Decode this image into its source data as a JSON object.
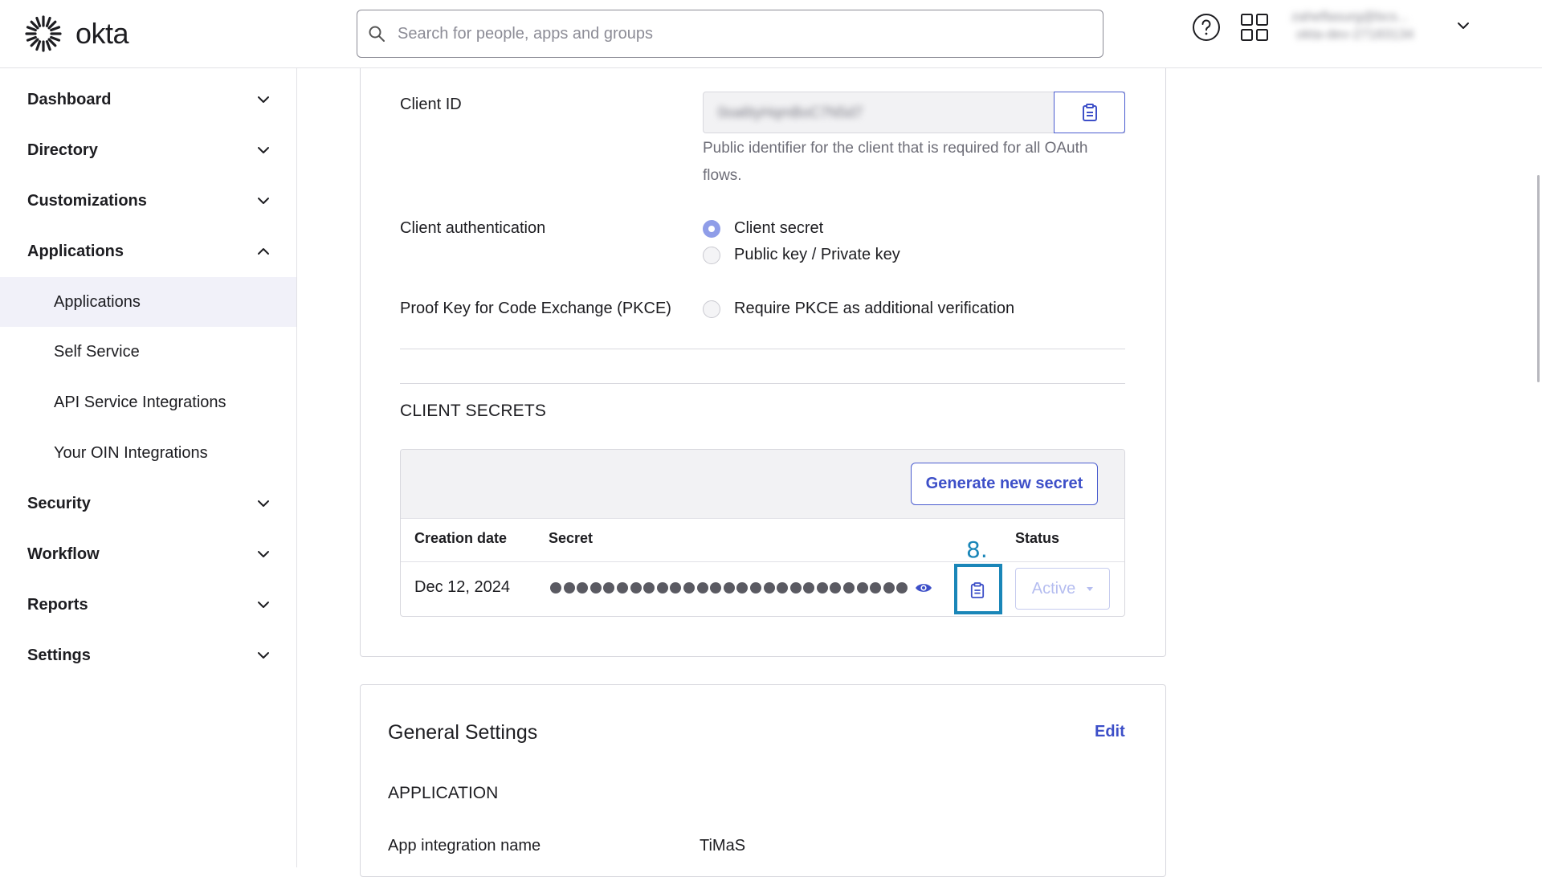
{
  "brand": {
    "name": "okta"
  },
  "search": {
    "placeholder": "Search for people, apps and groups"
  },
  "header": {
    "user_email": "zaheflasurg@bcs...",
    "user_org": "okta-dev-27183134",
    "help_icon": "help-circle-icon",
    "apps_icon": "grid-apps-icon"
  },
  "sidebar": {
    "items": [
      {
        "label": "Dashboard",
        "expanded": false
      },
      {
        "label": "Directory",
        "expanded": false
      },
      {
        "label": "Customizations",
        "expanded": false
      },
      {
        "label": "Applications",
        "expanded": true
      },
      {
        "label": "Security",
        "expanded": false
      },
      {
        "label": "Workflow",
        "expanded": false
      },
      {
        "label": "Reports",
        "expanded": false
      },
      {
        "label": "Settings",
        "expanded": false
      }
    ],
    "sub_items": [
      {
        "label": "Applications",
        "active": true
      },
      {
        "label": "Self Service",
        "active": false
      },
      {
        "label": "API Service Integrations",
        "active": false
      },
      {
        "label": "Your OIN Integrations",
        "active": false
      }
    ]
  },
  "client_credentials": {
    "client_id_label": "Client ID",
    "client_id_value": "0oa6tyHqmBoC7N5d7",
    "client_id_help": "Public identifier for the client that is required for all OAuth flows.",
    "client_auth_label": "Client authentication",
    "client_auth_options": [
      {
        "label": "Client secret",
        "checked": true
      },
      {
        "label": "Public key / Private key",
        "checked": false
      }
    ],
    "pkce_label": "Proof Key for Code Exchange (PKCE)",
    "pkce_option": {
      "label": "Require PKCE as additional verification",
      "checked": false
    }
  },
  "client_secrets": {
    "title": "CLIENT SECRETS",
    "generate_button": "Generate new secret",
    "columns": [
      "Creation date",
      "Secret",
      "Status"
    ],
    "rows": [
      {
        "creation_date": "Dec 12, 2024",
        "secret_masked": true,
        "status": "Active"
      }
    ],
    "annotation": "8."
  },
  "general_settings": {
    "title": "General Settings",
    "edit_label": "Edit",
    "application_heading": "APPLICATION",
    "fields": [
      {
        "label": "App integration name",
        "value": "TiMaS"
      }
    ]
  },
  "colors": {
    "accent": "#3d4fc8",
    "annotation": "#1a86b8",
    "active_nav_bg": "#f1f1f9"
  }
}
